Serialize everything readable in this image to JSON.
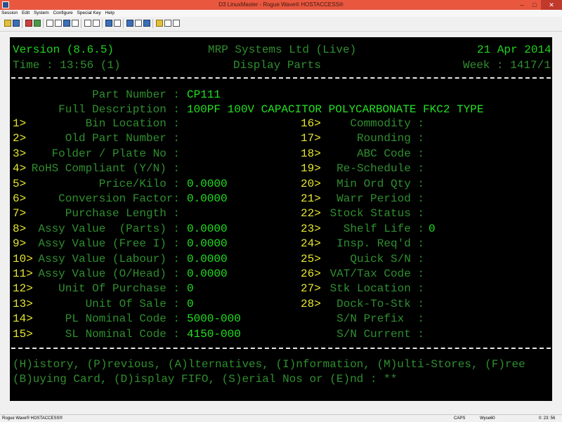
{
  "window": {
    "title": "D3 LinuxMaster - Rogue Wave® HOSTACCESS®",
    "minimize": "–",
    "maximize": "□",
    "close": "✕"
  },
  "menu": [
    "Session",
    "Edit",
    "System",
    "Configure",
    "Special Key",
    "Help"
  ],
  "terminal": {
    "header": {
      "version": "Version (8.6.5)",
      "company": "MRP Systems Ltd (Live)",
      "date": "21 Apr 2014",
      "time": "Time : 13:56 (1)",
      "screen": "Display Parts",
      "week": "Week : 1417/1"
    },
    "part_number": {
      "label": "Part Number :",
      "value": "CP111"
    },
    "full_description": {
      "label": "Full Description :",
      "value": "100PF 100V CAPACITOR POLYCARBONATE FKC2 TYPE"
    },
    "left_fields": [
      {
        "num": "1>",
        "label": "Bin Location :",
        "value": ""
      },
      {
        "num": "2>",
        "label": "Old Part Number :",
        "value": ""
      },
      {
        "num": "3>",
        "label": "Folder / Plate No :",
        "value": ""
      },
      {
        "num": "4>",
        "label": "RoHS Compliant (Y/N) :",
        "value": ""
      },
      {
        "num": "5>",
        "label": "Price/Kilo :",
        "value": "0.0000"
      },
      {
        "num": "6>",
        "label": "Conversion Factor:",
        "value": "0.0000"
      },
      {
        "num": "7>",
        "label": "Purchase Length :",
        "value": ""
      },
      {
        "num": "8>",
        "label": "Assy Value  (Parts) :",
        "value": "0.0000"
      },
      {
        "num": "9>",
        "label": "Assy Value (Free I) :",
        "value": "0.0000"
      },
      {
        "num": "10>",
        "label": "Assy Value (Labour) :",
        "value": "0.0000"
      },
      {
        "num": "11>",
        "label": "Assy Value (O/Head) :",
        "value": "0.0000"
      },
      {
        "num": "12>",
        "label": "Unit Of Purchase :",
        "value": "0"
      },
      {
        "num": "13>",
        "label": "Unit Of Sale :",
        "value": "0"
      },
      {
        "num": "14>",
        "label": "PL Nominal Code :",
        "value": "5000-000"
      },
      {
        "num": "15>",
        "label": "SL Nominal Code :",
        "value": "4150-000"
      }
    ],
    "right_fields": [
      {
        "num": "16>",
        "label": "Commodity :",
        "value": ""
      },
      {
        "num": "17>",
        "label": "Rounding :",
        "value": ""
      },
      {
        "num": "18>",
        "label": "ABC Code :",
        "value": ""
      },
      {
        "num": "19>",
        "label": "Re-Schedule :",
        "value": ""
      },
      {
        "num": "20>",
        "label": "Min Ord Qty :",
        "value": ""
      },
      {
        "num": "21>",
        "label": "Warr Period :",
        "value": ""
      },
      {
        "num": "22>",
        "label": "Stock Status :",
        "value": ""
      },
      {
        "num": "23>",
        "label": "Shelf Life :",
        "value": "0"
      },
      {
        "num": "24>",
        "label": "Insp. Req'd :",
        "value": ""
      },
      {
        "num": "25>",
        "label": "Quick S/N :",
        "value": ""
      },
      {
        "num": "26>",
        "label": "VAT/Tax Code :",
        "value": ""
      },
      {
        "num": "27>",
        "label": "Stk Location :",
        "value": ""
      },
      {
        "num": "28>",
        "label": "Dock-To-Stk :",
        "value": ""
      },
      {
        "num": "",
        "label": "S/N Prefix  :",
        "value": ""
      },
      {
        "num": "",
        "label": "S/N Current :",
        "value": ""
      }
    ],
    "prompt_line1": "(H)istory, (P)revious, (A)lternatives, (I)nformation, (M)ulti-Stores, (F)ree",
    "prompt_line2": "(B)uying Card, (D)isplay FIFO, (S)erial Nos or (E)nd : **"
  },
  "status": {
    "left": "Rogue Wave® HOSTACCESS®",
    "caps": "CAPS",
    "emulation": "Wyse60",
    "clock": "0: 23: 56"
  }
}
